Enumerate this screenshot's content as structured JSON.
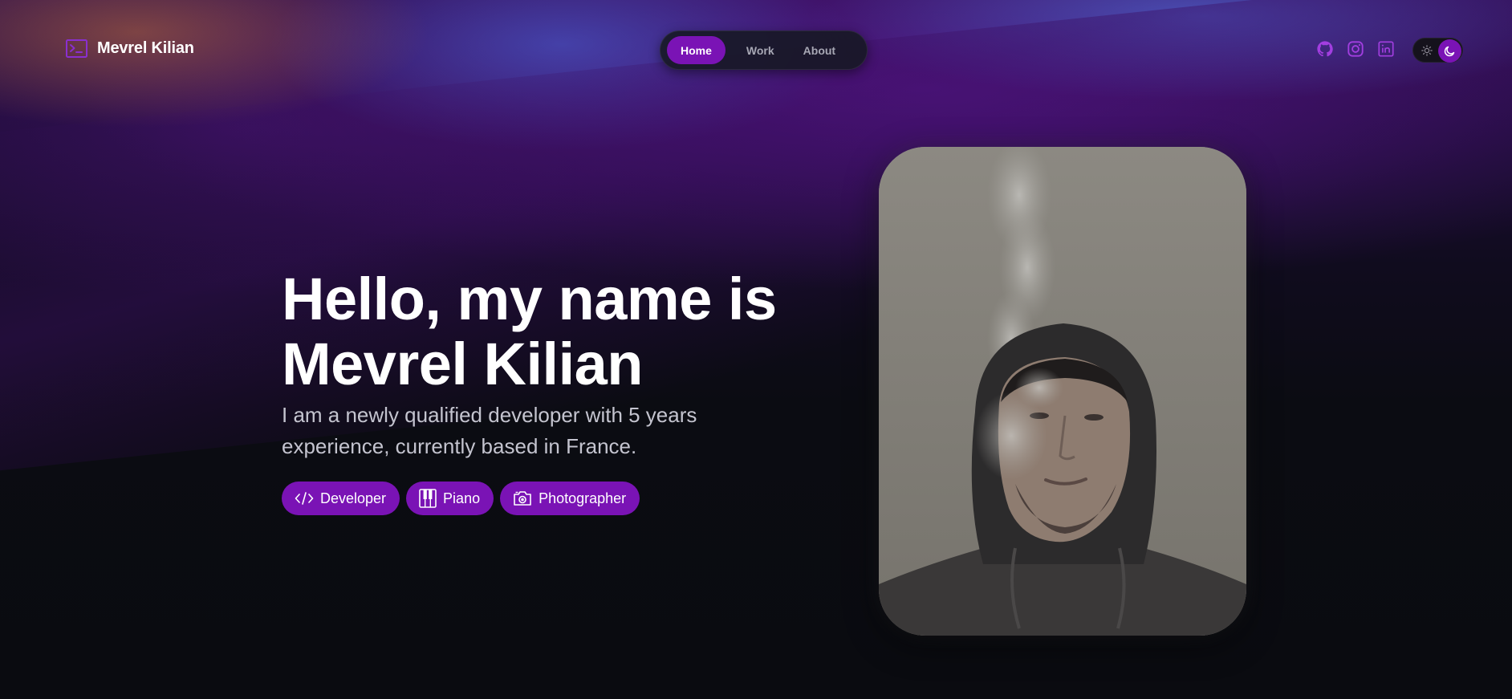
{
  "header": {
    "brand_name": "Mevrel Kilian",
    "brand_icon": "terminal-icon",
    "nav": [
      {
        "label": "Home",
        "active": true
      },
      {
        "label": "Work",
        "active": false
      },
      {
        "label": "About",
        "active": false
      }
    ],
    "social_icons": [
      "github-icon",
      "instagram-icon",
      "linkedin-icon"
    ],
    "theme_toggle": {
      "options": [
        "sun-icon",
        "moon-icon"
      ],
      "selected": "dark"
    }
  },
  "hero": {
    "title_line1": "Hello, my name is",
    "title_line2": "Mevrel Kilian",
    "subtitle_line1": "I am a newly qualified developer with 5 years",
    "subtitle_line2": "experience, currently based in France.",
    "tags": [
      {
        "label": "Developer",
        "icon": "code-icon"
      },
      {
        "label": "Piano",
        "icon": "piano-icon"
      },
      {
        "label": "Photographer",
        "icon": "camera-icon"
      }
    ]
  },
  "colors": {
    "accent": "#7a13b5",
    "background": "#0a0b10",
    "text": "#ffffff",
    "muted_text": "#c4c4cf",
    "nav_inactive": "#a7a7b4"
  }
}
